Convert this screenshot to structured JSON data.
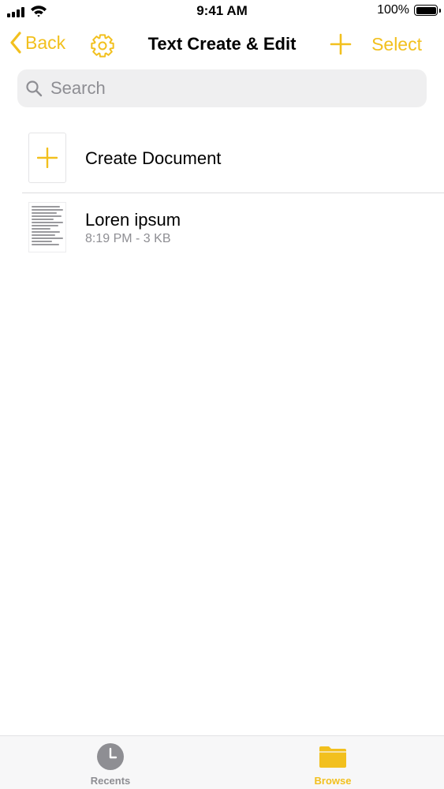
{
  "colors": {
    "accent": "#f2c01e",
    "inactive": "#8e8e93"
  },
  "status_bar": {
    "time": "9:41 AM",
    "battery_pct": "100%",
    "battery_level": 1.0,
    "icons": [
      "signal-icon",
      "wifi-icon",
      "battery-icon"
    ]
  },
  "nav": {
    "back_label": "Back",
    "title": "Text Create & Edit",
    "select_label": "Select",
    "icons": [
      "chevron-left-icon",
      "gear-icon",
      "plus-icon"
    ]
  },
  "search": {
    "placeholder": "Search",
    "value": ""
  },
  "list": {
    "create_label": "Create Document",
    "documents": [
      {
        "title": "Loren ipsum",
        "meta": "8:19 PM - 3 KB"
      }
    ]
  },
  "tab_bar": {
    "tabs": [
      {
        "label": "Recents",
        "icon": "clock-icon",
        "active": false
      },
      {
        "label": "Browse",
        "icon": "folder-icon",
        "active": true
      }
    ]
  }
}
